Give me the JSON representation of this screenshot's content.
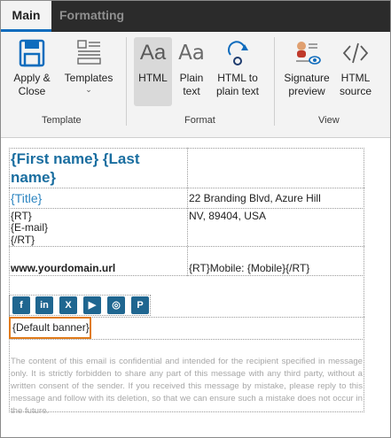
{
  "tabs": {
    "main": "Main",
    "formatting": "Formatting"
  },
  "ribbon": {
    "apply_close": "Apply &\nClose",
    "templates": "Templates",
    "group_template": "Template",
    "html": "HTML",
    "plain_text": "Plain\ntext",
    "html_to_plain": "HTML to\nplain text",
    "group_format": "Format",
    "sig_preview": "Signature\npreview",
    "html_source": "HTML\nsource",
    "group_view": "View"
  },
  "signature": {
    "name": "{First name} {Last name}",
    "title": "{Title}",
    "address_line1": "22 Branding Blvd, Azure Hill",
    "address_line2": "NV, 89404, USA",
    "rt_open": "{RT}",
    "email": "{E-mail}",
    "rt_close": "{/RT}",
    "domain": "www.yourdomain.url",
    "mobile": "{RT}Mobile: {Mobile}{/RT}",
    "banner": "{Default banner}",
    "social": [
      "f",
      "in",
      "X",
      "▶",
      "◎",
      "P"
    ],
    "disclaimer": "The content of this email is confidential and intended for the recipient specified in message only. It is strictly forbidden to share any part of this message with any third party, without a written consent of the sender. If you received this message by mistake, please reply to this message and follow with its deletion, so that we can ensure such a mistake does not occur in the future."
  }
}
